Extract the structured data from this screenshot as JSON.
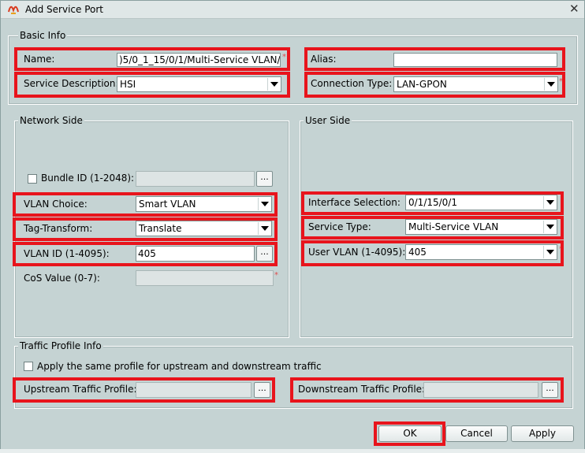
{
  "window": {
    "title": "Add Service Port",
    "close_glyph": "✕"
  },
  "basic_info": {
    "group_label": "Basic Info",
    "name": {
      "label": "Name:",
      "value": ")5/0_1_15/0/1/Multi-Service VLAN/405"
    },
    "alias": {
      "label": "Alias:",
      "value": ""
    },
    "service_description": {
      "label": "Service Description:",
      "value": "HSI"
    },
    "connection_type": {
      "label": "Connection Type:",
      "value": "LAN-GPON"
    }
  },
  "network_side": {
    "group_label": "Network Side",
    "bundle_id": {
      "label": "Bundle ID (1-2048):",
      "value": ""
    },
    "vlan_choice": {
      "label": "VLAN Choice:",
      "value": "Smart VLAN"
    },
    "tag_transform": {
      "label": "Tag-Transform:",
      "value": "Translate"
    },
    "vlan_id": {
      "label": "VLAN ID (1-4095):",
      "value": "405"
    },
    "cos_value": {
      "label": "CoS Value (0-7):",
      "value": ""
    }
  },
  "user_side": {
    "group_label": "User Side",
    "interface_selection": {
      "label": "Interface Selection:",
      "value": "0/1/15/0/1"
    },
    "service_type": {
      "label": "Service Type:",
      "value": "Multi-Service VLAN"
    },
    "user_vlan": {
      "label": "User VLAN (1-4095):",
      "value": "405"
    }
  },
  "traffic_profile": {
    "group_label": "Traffic Profile Info",
    "same_profile_label": "Apply the same profile for upstream and downstream traffic",
    "upstream": {
      "label": "Upstream Traffic Profile:",
      "value": ""
    },
    "downstream": {
      "label": "Downstream Traffic Profile:",
      "value": ""
    }
  },
  "common": {
    "browse_label": "...",
    "required_mark": "*"
  },
  "buttons": {
    "ok": "OK",
    "cancel": "Cancel",
    "apply": "Apply"
  },
  "colors": {
    "highlight": "#e8141c",
    "background": "#c5d3d3"
  }
}
